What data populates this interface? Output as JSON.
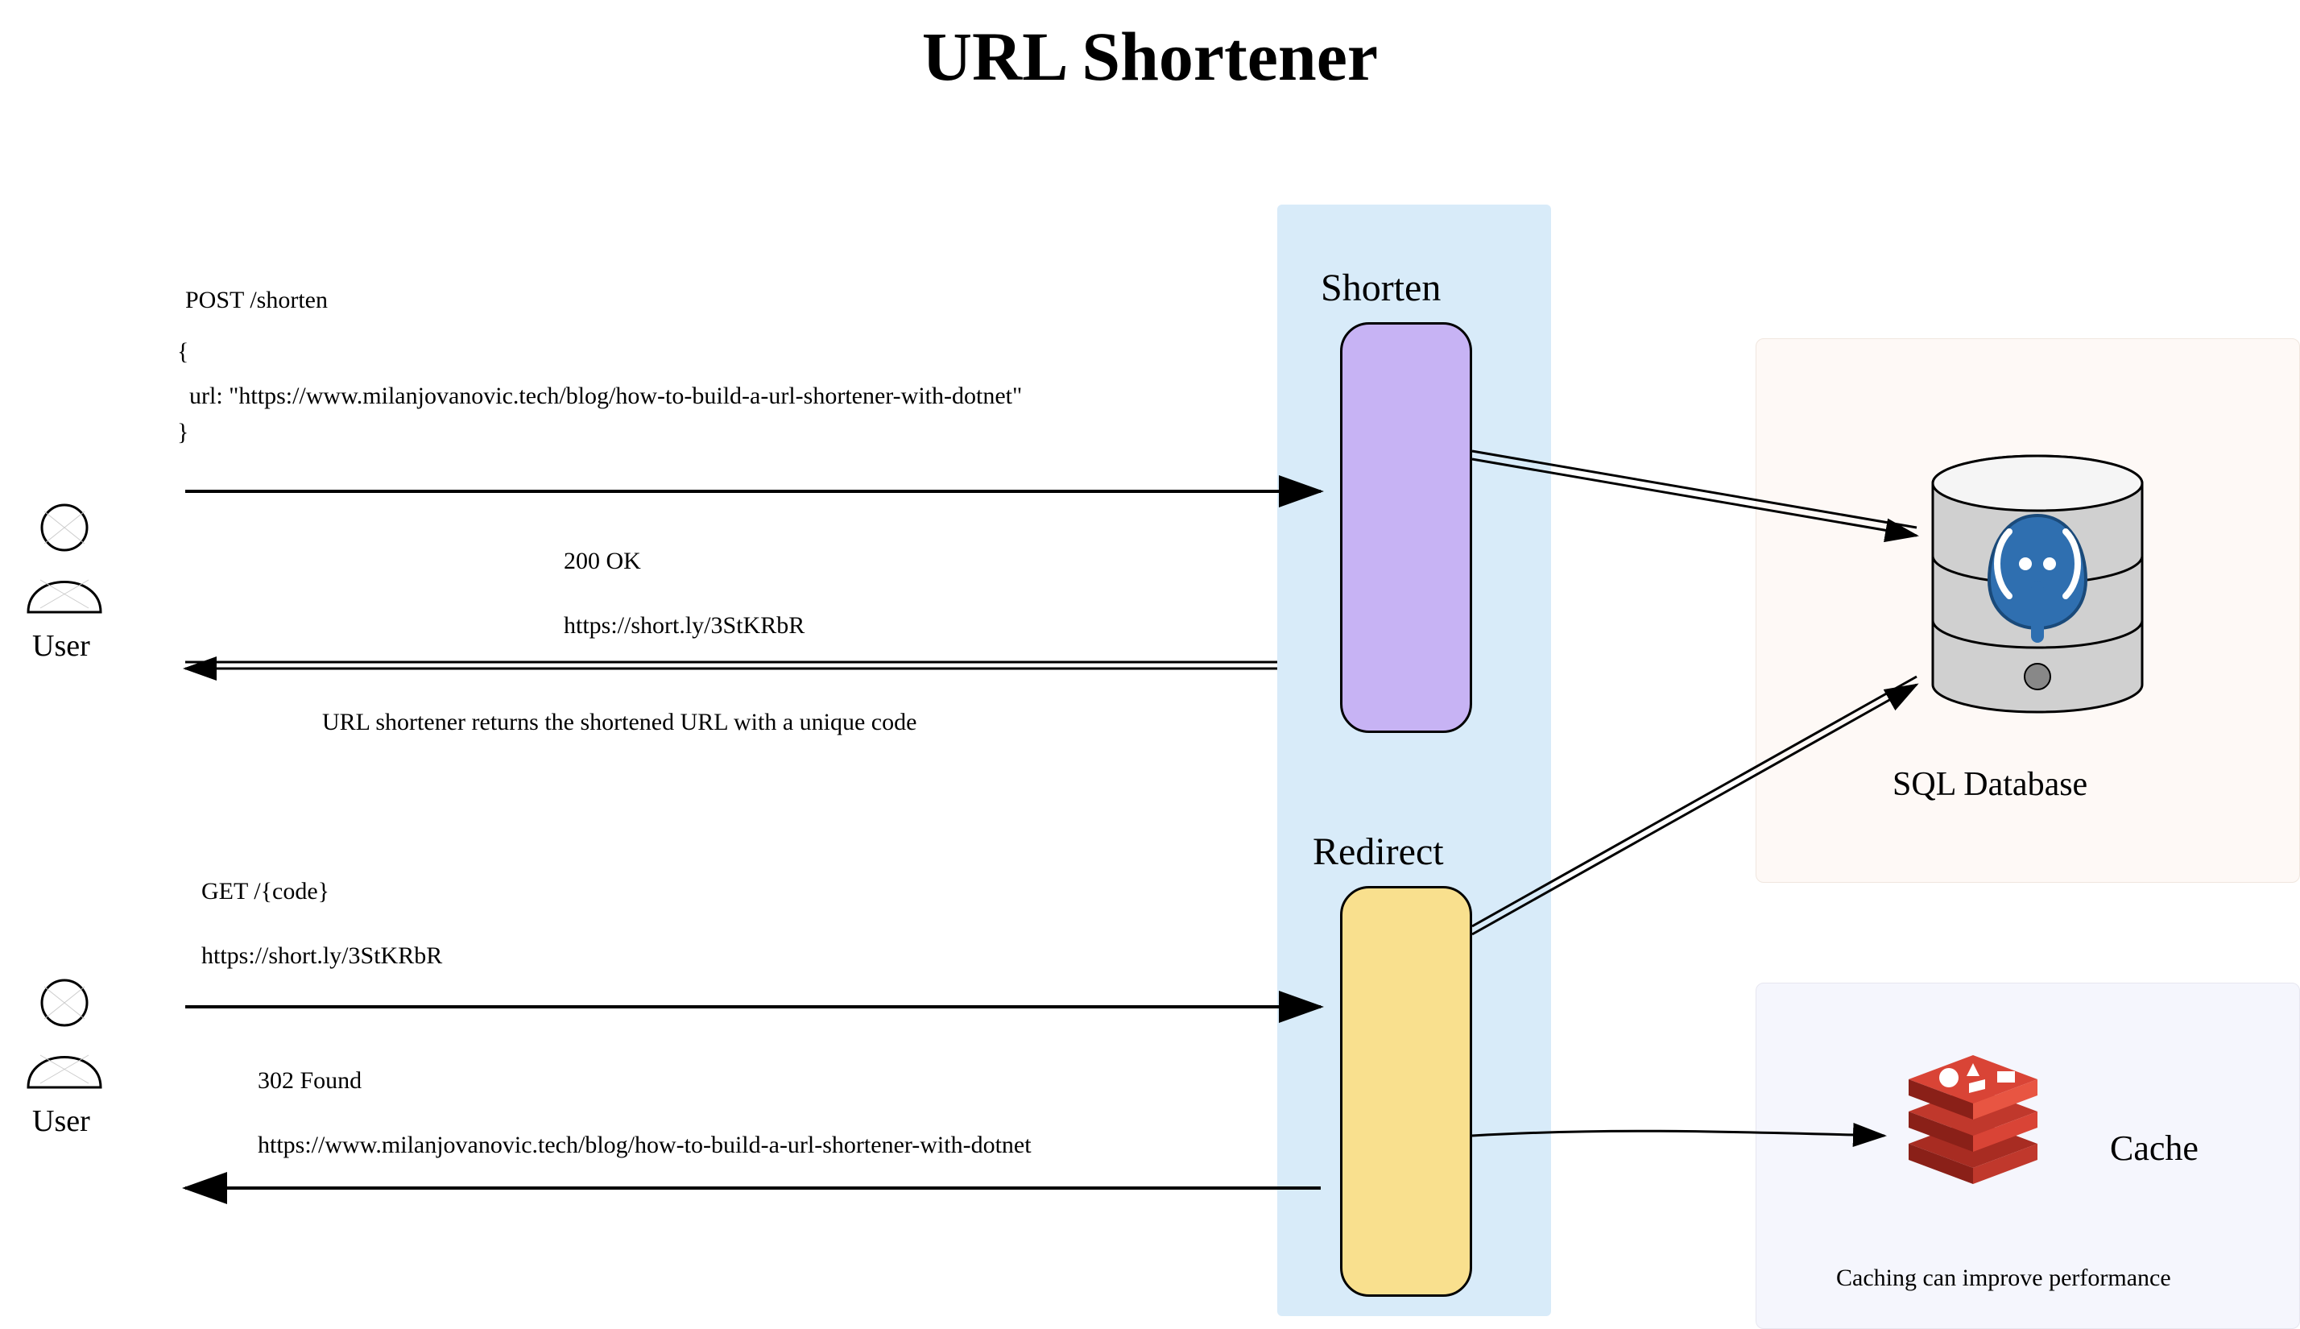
{
  "title": "URL Shortener",
  "users": {
    "label": "User"
  },
  "services": {
    "shorten": "Shorten",
    "redirect": "Redirect"
  },
  "flow1": {
    "request_line1": "POST /shorten",
    "request_line2": "{",
    "request_line3": "  url: \"https://www.milanjovanovic.tech/blog/how-to-build-a-url-shortener-with-dotnet\"",
    "request_line4": "}",
    "response_status": "200 OK",
    "response_url": "https://short.ly/3StKRbR",
    "response_note": "URL shortener returns the shortened URL with a unique code"
  },
  "flow2": {
    "request_line1": "GET /{code}",
    "request_url": "https://short.ly/3StKRbR",
    "response_status": "302 Found",
    "response_url": "https://www.milanjovanovic.tech/blog/how-to-build-a-url-shortener-with-dotnet"
  },
  "db": {
    "label": "SQL Database"
  },
  "cache": {
    "label": "Cache",
    "note": "Caching can improve performance"
  }
}
